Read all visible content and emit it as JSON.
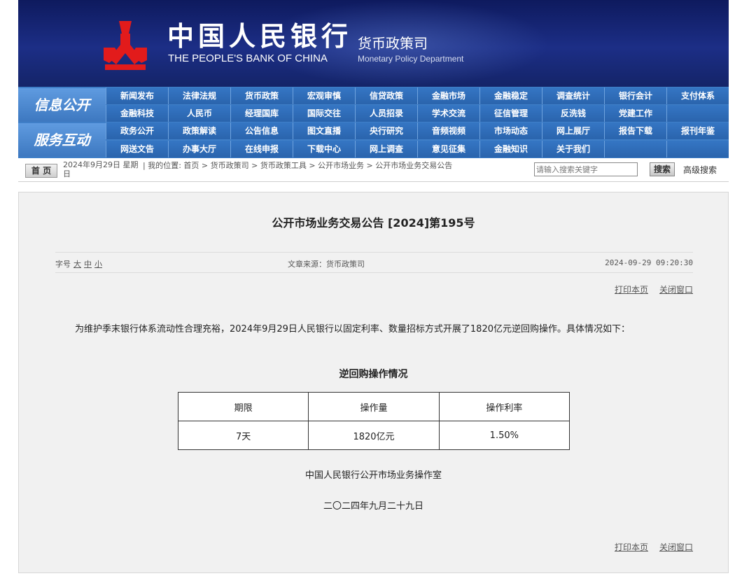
{
  "header": {
    "bank_name_cn": "中国人民银行",
    "bank_name_en": "THE PEOPLE'S BANK OF CHINA",
    "dept_name_cn": "货币政策司",
    "dept_name_en": "Monetary Policy Department",
    "logo_icon": "pboc-logo-icon"
  },
  "nav": {
    "label_info": "信息公开",
    "label_service": "服务互动",
    "row1": [
      "新闻发布",
      "法律法规",
      "货币政策",
      "宏观审慎",
      "信贷政策",
      "金融市场",
      "金融稳定",
      "调查统计",
      "银行会计",
      "支付体系"
    ],
    "row2": [
      "金融科技",
      "人民币",
      "经理国库",
      "国际交往",
      "人员招录",
      "学术交流",
      "征信管理",
      "反洗钱",
      "党建工作",
      ""
    ],
    "row3": [
      "政务公开",
      "政策解读",
      "公告信息",
      "图文直播",
      "央行研究",
      "音频视频",
      "市场动态",
      "网上展厅",
      "报告下载",
      "报刊年鉴"
    ],
    "row4": [
      "网送文告",
      "办事大厅",
      "在线申报",
      "下载中心",
      "网上调查",
      "意见征集",
      "金融知识",
      "关于我们",
      "",
      ""
    ]
  },
  "infobar": {
    "home": "首 页",
    "date": "2024年9月29日 星期日",
    "breadcrumb": "|  我的位置: 首页  >  货币政策司  >  货币政策工具  >  公开市场业务  >  公开市场业务交易公告",
    "search_placeholder": "请输入搜索关键字",
    "search_button": "搜索",
    "advanced_search": "高级搜索"
  },
  "article": {
    "title": "公开市场业务交易公告 [2024]第195号",
    "font_size_label": "字号",
    "font_large": "大",
    "font_medium": "中",
    "font_small": "小",
    "source": "文章来源：货币政策司",
    "datetime": "2024-09-29 09:20:30",
    "print": "打印本页",
    "close": "关闭窗口",
    "body": "为维护季末银行体系流动性合理充裕，2024年9月29日人民银行以固定利率、数量招标方式开展了1820亿元逆回购操作。具体情况如下：",
    "table_title": "逆回购操作情况",
    "table": {
      "headers": [
        "期限",
        "操作量",
        "操作利率"
      ],
      "rows": [
        [
          "7天",
          "1820亿元",
          "1.50%"
        ]
      ]
    },
    "signature": "中国人民银行公开市场业务操作室",
    "sign_date": "二〇二四年九月二十九日"
  }
}
